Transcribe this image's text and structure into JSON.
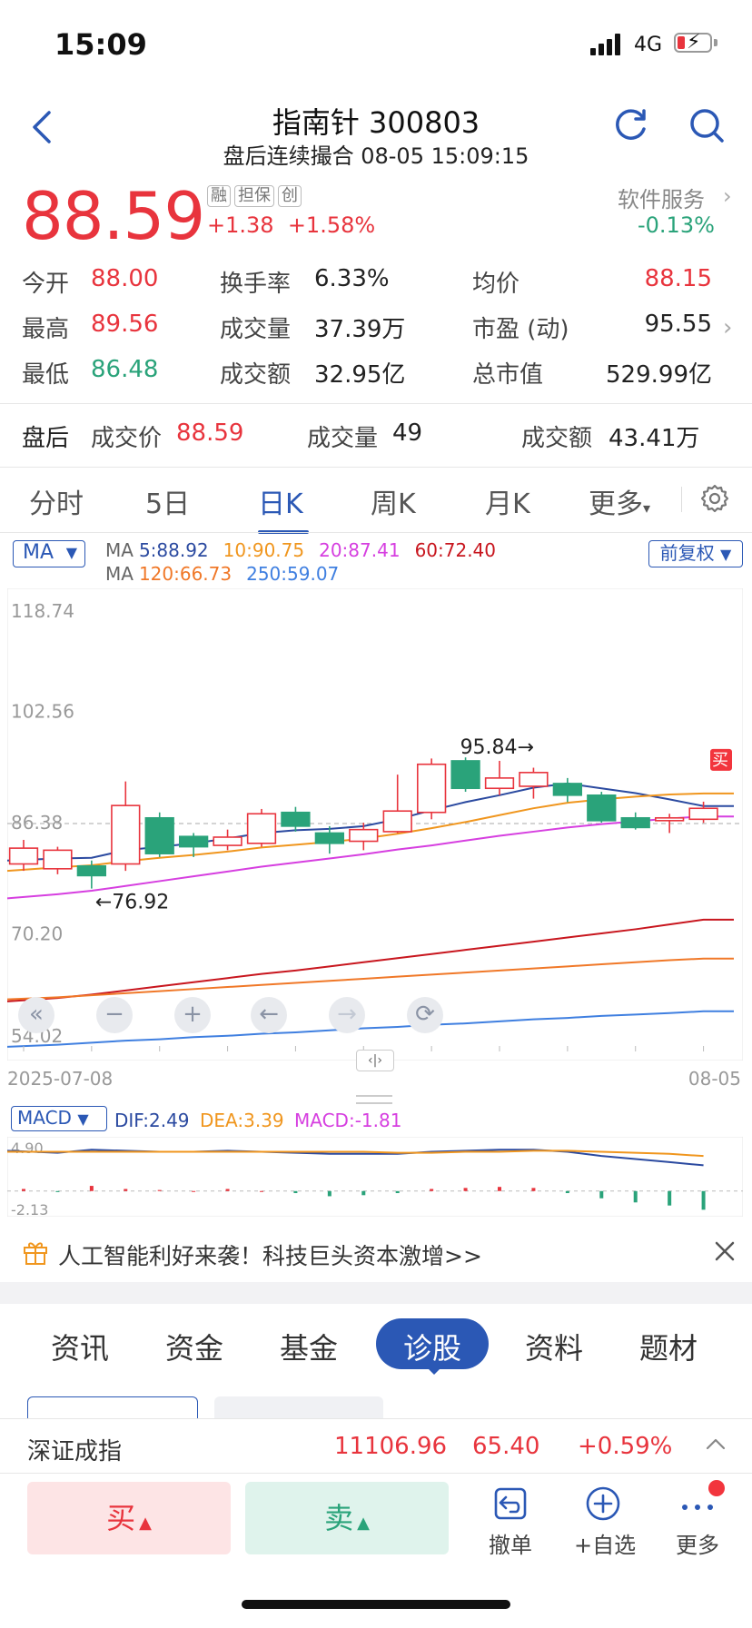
{
  "status": {
    "time": "15:09",
    "network": "4G"
  },
  "header": {
    "title": "指南针 300803",
    "subtitle": "盘后连续撮合 08-05 15:09:15"
  },
  "quote": {
    "price": "88.59",
    "tags": [
      "融",
      "担保",
      "创"
    ],
    "change": "+1.38",
    "change_pct": "+1.58%",
    "service_label": "软件服务",
    "service_change": "-0.13%"
  },
  "stats": [
    [
      {
        "k": "今开",
        "v": "88.00",
        "c": "#e8343d"
      },
      {
        "k": "换手率",
        "v": "6.33%",
        "c": "#222"
      },
      {
        "k": "均价",
        "v": "88.15",
        "c": "#e8343d"
      }
    ],
    [
      {
        "k": "最高",
        "v": "89.56",
        "c": "#e8343d"
      },
      {
        "k": "成交量",
        "v": "37.39万",
        "c": "#222"
      },
      {
        "k": "市盈 (动)",
        "v": "95.55",
        "c": "#222"
      }
    ],
    [
      {
        "k": "最低",
        "v": "86.48",
        "c": "#2aa37a"
      },
      {
        "k": "成交额",
        "v": "32.95亿",
        "c": "#222"
      },
      {
        "k": "总市值",
        "v": "529.99亿",
        "c": "#222"
      }
    ]
  ],
  "after_hours": {
    "label": "盘后",
    "price_label": "成交价",
    "price": "88.59",
    "vol_label": "成交量",
    "vol": "49",
    "amt_label": "成交额",
    "amt": "43.41万"
  },
  "period_tabs": [
    "分时",
    "5日",
    "日K",
    "周K",
    "月K",
    "更多"
  ],
  "active_tab": "日K",
  "ma": {
    "button": "MA",
    "fq": "前复权",
    "row1": [
      {
        "t": "MA",
        "c": "#666"
      },
      {
        "t": "5:88.92",
        "c": "#2b4aa0"
      },
      {
        "t": "10:90.75",
        "c": "#f0961e"
      },
      {
        "t": "20:87.41",
        "c": "#d63fe0"
      },
      {
        "t": "60:72.40",
        "c": "#c8161e"
      }
    ],
    "row2": [
      {
        "t": "MA",
        "c": "#666"
      },
      {
        "t": "120:66.73",
        "c": "#f07828"
      },
      {
        "t": "250:59.07",
        "c": "#3f7fe0"
      }
    ]
  },
  "chart_data": {
    "type": "candlestick",
    "ylim": [
      54.02,
      118.74
    ],
    "y_ticks": [
      "118.74",
      "102.56",
      "86.38",
      "70.20",
      "54.02"
    ],
    "x_start": "2025-07-08",
    "x_end": "08-05",
    "max_label": "95.84→",
    "min_label": "←76.92",
    "current_line": 86.38,
    "buy_marker": "买",
    "candles": [
      {
        "o": 80.5,
        "c": 82.8,
        "h": 84.0,
        "l": 79.5
      },
      {
        "o": 79.8,
        "c": 82.5,
        "h": 83.0,
        "l": 79.0
      },
      {
        "o": 80.2,
        "c": 78.8,
        "h": 81.0,
        "l": 76.92
      },
      {
        "o": 80.5,
        "c": 89.0,
        "h": 92.5,
        "l": 79.5
      },
      {
        "o": 87.2,
        "c": 82.0,
        "h": 88.0,
        "l": 81.5
      },
      {
        "o": 84.5,
        "c": 83.0,
        "h": 85.0,
        "l": 81.5
      },
      {
        "o": 83.2,
        "c": 84.4,
        "h": 85.5,
        "l": 82.5
      },
      {
        "o": 83.5,
        "c": 87.8,
        "h": 88.5,
        "l": 83.0
      },
      {
        "o": 88.0,
        "c": 86.0,
        "h": 88.8,
        "l": 85.2
      },
      {
        "o": 85.0,
        "c": 83.5,
        "h": 86.0,
        "l": 82.0
      },
      {
        "o": 83.8,
        "c": 85.5,
        "h": 86.5,
        "l": 82.5
      },
      {
        "o": 85.2,
        "c": 88.2,
        "h": 93.5,
        "l": 85.0
      },
      {
        "o": 88.0,
        "c": 95.0,
        "h": 95.84,
        "l": 87.0
      },
      {
        "o": 95.5,
        "c": 91.5,
        "h": 96.0,
        "l": 91.0
      },
      {
        "o": 91.5,
        "c": 93.0,
        "h": 95.5,
        "l": 90.5
      },
      {
        "o": 91.8,
        "c": 93.8,
        "h": 94.5,
        "l": 90.0
      },
      {
        "o": 92.2,
        "c": 90.5,
        "h": 93.0,
        "l": 89.5
      },
      {
        "o": 90.5,
        "c": 86.8,
        "h": 91.0,
        "l": 86.5
      },
      {
        "o": 87.2,
        "c": 85.8,
        "h": 88.0,
        "l": 85.5
      },
      {
        "o": 86.8,
        "c": 87.2,
        "h": 87.8,
        "l": 85.0
      },
      {
        "o": 87.0,
        "c": 88.59,
        "h": 89.56,
        "l": 86.48
      }
    ],
    "series": [
      {
        "name": "MA5",
        "color": "#2b4aa0",
        "values": [
          81.0,
          81.3,
          81.4,
          82.5,
          83.0,
          83.5,
          84.2,
          85.0,
          85.4,
          85.6,
          86.0,
          87.0,
          88.3,
          89.5,
          90.5,
          91.6,
          92.2,
          91.5,
          90.8,
          89.9,
          88.92
        ]
      },
      {
        "name": "MA10",
        "color": "#f0961e",
        "values": [
          79.5,
          80.0,
          80.3,
          80.9,
          81.4,
          81.8,
          82.3,
          82.9,
          83.3,
          83.7,
          84.2,
          84.9,
          85.7,
          86.6,
          87.6,
          88.6,
          89.4,
          89.9,
          90.3,
          90.6,
          90.75
        ]
      },
      {
        "name": "MA20",
        "color": "#d63fe0",
        "values": [
          75.5,
          76.1,
          76.6,
          77.3,
          78.0,
          78.7,
          79.4,
          80.1,
          80.7,
          81.3,
          81.9,
          82.6,
          83.2,
          83.9,
          84.6,
          85.2,
          85.8,
          86.3,
          86.7,
          87.1,
          87.41
        ]
      },
      {
        "name": "MA60",
        "color": "#c8161e",
        "values": [
          60.5,
          61.0,
          61.5,
          62.1,
          62.7,
          63.3,
          63.9,
          64.5,
          65.0,
          65.6,
          66.2,
          66.8,
          67.4,
          68.0,
          68.6,
          69.2,
          69.8,
          70.4,
          71.0,
          71.7,
          72.4
        ]
      },
      {
        "name": "MA120",
        "color": "#f07828",
        "values": [
          60.8,
          61.1,
          61.4,
          61.7,
          62.0,
          62.3,
          62.6,
          62.9,
          63.2,
          63.5,
          63.8,
          64.1,
          64.4,
          64.7,
          65.0,
          65.3,
          65.6,
          65.9,
          66.2,
          66.5,
          66.73
        ]
      },
      {
        "name": "MA250",
        "color": "#3f7fe0",
        "values": [
          53.9,
          54.2,
          54.5,
          54.8,
          55.0,
          55.3,
          55.5,
          55.8,
          56.0,
          56.3,
          56.6,
          56.8,
          57.1,
          57.3,
          57.6,
          57.9,
          58.1,
          58.4,
          58.6,
          58.8,
          59.07
        ]
      }
    ]
  },
  "tools": [
    "«",
    "−",
    "+",
    "←",
    "→",
    "⟳"
  ],
  "macd": {
    "button": "MACD",
    "dif": "DIF:2.49",
    "dea": "DEA:3.39",
    "macd": "MACD:-1.81",
    "top": "4.90",
    "bottom": "-2.13",
    "dif_values": [
      3.9,
      3.7,
      4.0,
      3.9,
      3.8,
      3.8,
      3.9,
      3.8,
      3.7,
      3.6,
      3.6,
      3.6,
      3.8,
      3.9,
      4.0,
      4.0,
      3.8,
      3.4,
      3.1,
      2.8,
      2.49
    ],
    "dea_values": [
      3.8,
      3.8,
      3.8,
      3.8,
      3.8,
      3.8,
      3.8,
      3.8,
      3.8,
      3.8,
      3.8,
      3.7,
      3.7,
      3.8,
      3.8,
      3.9,
      3.9,
      3.8,
      3.7,
      3.6,
      3.39
    ],
    "hist_values": [
      0.2,
      -0.1,
      0.5,
      0.2,
      0.1,
      0.0,
      0.2,
      0.0,
      -0.2,
      -0.5,
      -0.4,
      -0.2,
      0.2,
      0.3,
      0.4,
      0.3,
      -0.2,
      -0.7,
      -1.1,
      -1.4,
      -1.81
    ]
  },
  "banner": {
    "text": "人工智能利好来袭！科技巨头资本激增>>"
  },
  "feature_tabs": [
    "资讯",
    "资金",
    "基金",
    "诊股",
    "资料",
    "题材"
  ],
  "feature_active": "诊股",
  "index_bar": {
    "name": "深证成指",
    "value": "11106.96",
    "change": "65.40",
    "pct": "+0.59%"
  },
  "actions": {
    "buy": "买",
    "sell": "卖",
    "cancel": "撤单",
    "watch": "+自选",
    "more": "更多"
  },
  "colors": {
    "up": "#e8343d",
    "down": "#2aa37a",
    "accent": "#2b58b5"
  }
}
